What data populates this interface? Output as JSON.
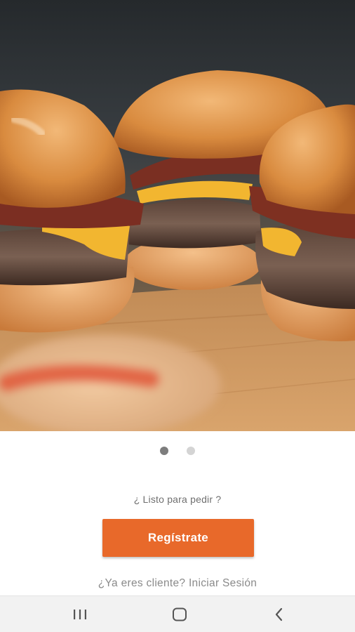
{
  "hero": {
    "image_icon": "burger-sliders-photo"
  },
  "pager": {
    "page_count": 2,
    "active_index": 0
  },
  "onboarding": {
    "prompt_text": "¿ Listo para pedir ?",
    "register_label": "Regístrate",
    "login_text": "¿Ya eres cliente? Iniciar Sesión"
  },
  "colors": {
    "accent": "#e8692a",
    "dot_active": "#7d7d7d",
    "dot_inactive": "#d4d4d4",
    "navbar_bg": "#f2f2f2"
  },
  "system_nav": {
    "recents_icon": "recents-icon",
    "home_icon": "home-icon",
    "back_icon": "back-icon"
  }
}
